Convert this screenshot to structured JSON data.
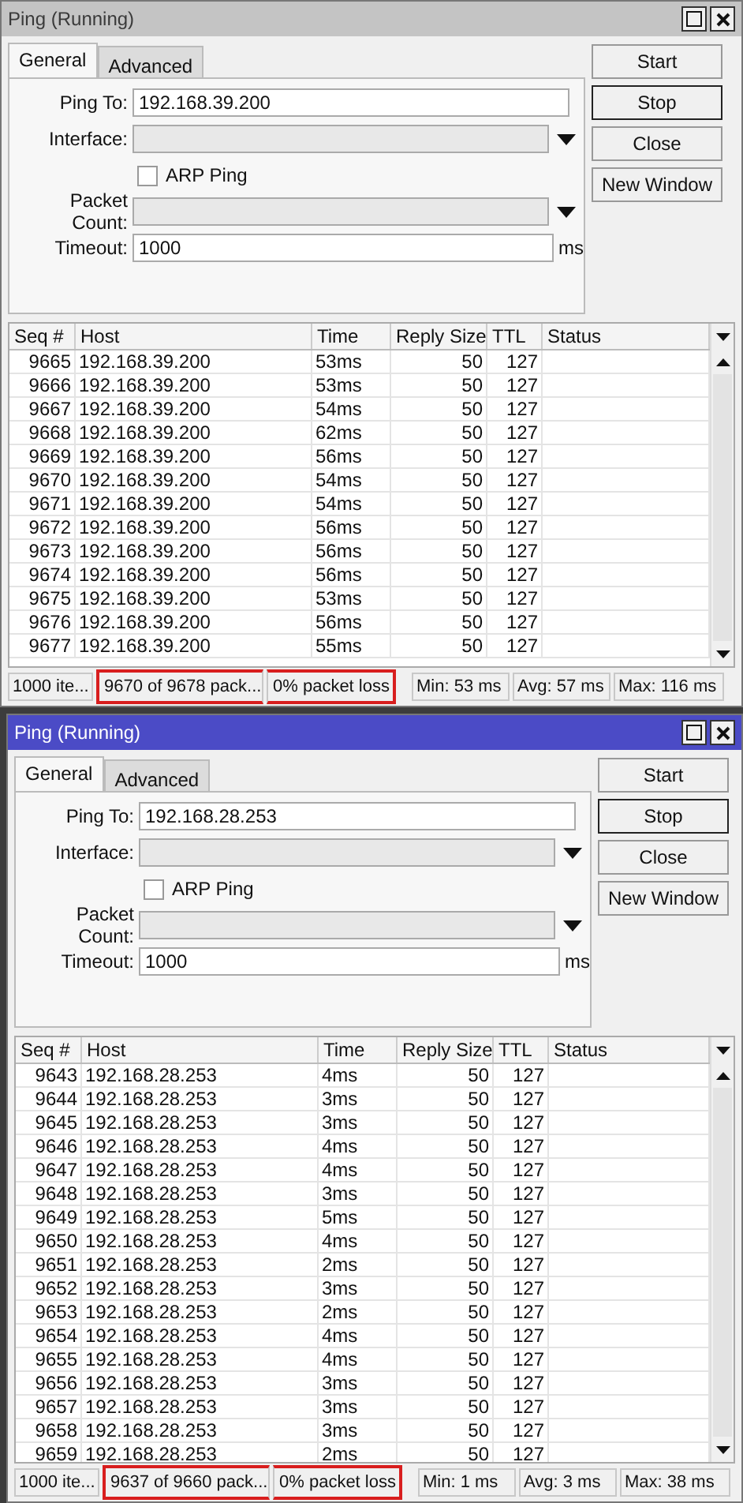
{
  "windows": [
    {
      "title": "Ping (Running)",
      "active": false,
      "tabs": [
        {
          "label": "General",
          "selected": true
        },
        {
          "label": "Advanced",
          "selected": false
        }
      ],
      "fields": [
        {
          "kind": "text",
          "label": "Ping To:",
          "value": "192.168.39.200"
        },
        {
          "kind": "dropdown",
          "label": "Interface:"
        },
        {
          "kind": "checkbox",
          "label": "ARP Ping",
          "checked": false
        },
        {
          "kind": "dropdown",
          "label": "Packet Count:"
        },
        {
          "kind": "text",
          "label": "Timeout:",
          "value": "1000",
          "unit": "ms"
        }
      ],
      "buttons": [
        {
          "label": "Start",
          "default": false
        },
        {
          "label": "Stop",
          "default": true
        },
        {
          "label": "Close",
          "default": false
        },
        {
          "label": "New Window",
          "default": false
        }
      ],
      "columns": [
        "Seq #",
        "Host",
        "Time",
        "Reply Size",
        "TTL",
        "Status"
      ],
      "rows": [
        [
          "9665",
          "192.168.39.200",
          "53ms",
          "50",
          "127"
        ],
        [
          "9666",
          "192.168.39.200",
          "53ms",
          "50",
          "127"
        ],
        [
          "9667",
          "192.168.39.200",
          "54ms",
          "50",
          "127"
        ],
        [
          "9668",
          "192.168.39.200",
          "62ms",
          "50",
          "127"
        ],
        [
          "9669",
          "192.168.39.200",
          "56ms",
          "50",
          "127"
        ],
        [
          "9670",
          "192.168.39.200",
          "54ms",
          "50",
          "127"
        ],
        [
          "9671",
          "192.168.39.200",
          "54ms",
          "50",
          "127"
        ],
        [
          "9672",
          "192.168.39.200",
          "56ms",
          "50",
          "127"
        ],
        [
          "9673",
          "192.168.39.200",
          "56ms",
          "50",
          "127"
        ],
        [
          "9674",
          "192.168.39.200",
          "56ms",
          "50",
          "127"
        ],
        [
          "9675",
          "192.168.39.200",
          "53ms",
          "50",
          "127"
        ],
        [
          "9676",
          "192.168.39.200",
          "56ms",
          "50",
          "127"
        ],
        [
          "9677",
          "192.168.39.200",
          "55ms",
          "50",
          "127"
        ]
      ],
      "status_bar": [
        {
          "text": "1000 ite...",
          "highlighted": false
        },
        {
          "text": "9670 of 9678 pack...",
          "highlighted": true
        },
        {
          "text": "0% packet loss",
          "highlighted": true
        },
        {
          "text": "Min: 53 ms",
          "highlighted": false
        },
        {
          "text": "Avg: 57 ms",
          "highlighted": false
        },
        {
          "text": "Max: 116 ms",
          "highlighted": false
        }
      ]
    },
    {
      "title": "Ping (Running)",
      "active": true,
      "tabs": [
        {
          "label": "General",
          "selected": true
        },
        {
          "label": "Advanced",
          "selected": false
        }
      ],
      "fields": [
        {
          "kind": "text",
          "label": "Ping To:",
          "value": "192.168.28.253"
        },
        {
          "kind": "dropdown",
          "label": "Interface:"
        },
        {
          "kind": "checkbox",
          "label": "ARP Ping",
          "checked": false
        },
        {
          "kind": "dropdown",
          "label": "Packet Count:"
        },
        {
          "kind": "text",
          "label": "Timeout:",
          "value": "1000",
          "unit": "ms"
        }
      ],
      "buttons": [
        {
          "label": "Start",
          "default": false
        },
        {
          "label": "Stop",
          "default": true
        },
        {
          "label": "Close",
          "default": false
        },
        {
          "label": "New Window",
          "default": false
        }
      ],
      "columns": [
        "Seq #",
        "Host",
        "Time",
        "Reply Size",
        "TTL",
        "Status"
      ],
      "rows": [
        [
          "9643",
          "192.168.28.253",
          "4ms",
          "50",
          "127"
        ],
        [
          "9644",
          "192.168.28.253",
          "3ms",
          "50",
          "127"
        ],
        [
          "9645",
          "192.168.28.253",
          "3ms",
          "50",
          "127"
        ],
        [
          "9646",
          "192.168.28.253",
          "4ms",
          "50",
          "127"
        ],
        [
          "9647",
          "192.168.28.253",
          "4ms",
          "50",
          "127"
        ],
        [
          "9648",
          "192.168.28.253",
          "3ms",
          "50",
          "127"
        ],
        [
          "9649",
          "192.168.28.253",
          "5ms",
          "50",
          "127"
        ],
        [
          "9650",
          "192.168.28.253",
          "4ms",
          "50",
          "127"
        ],
        [
          "9651",
          "192.168.28.253",
          "2ms",
          "50",
          "127"
        ],
        [
          "9652",
          "192.168.28.253",
          "3ms",
          "50",
          "127"
        ],
        [
          "9653",
          "192.168.28.253",
          "2ms",
          "50",
          "127"
        ],
        [
          "9654",
          "192.168.28.253",
          "4ms",
          "50",
          "127"
        ],
        [
          "9655",
          "192.168.28.253",
          "4ms",
          "50",
          "127"
        ],
        [
          "9656",
          "192.168.28.253",
          "3ms",
          "50",
          "127"
        ],
        [
          "9657",
          "192.168.28.253",
          "3ms",
          "50",
          "127"
        ],
        [
          "9658",
          "192.168.28.253",
          "3ms",
          "50",
          "127"
        ],
        [
          "9659",
          "192.168.28.253",
          "2ms",
          "50",
          "127"
        ]
      ],
      "status_bar": [
        {
          "text": "1000 ite...",
          "highlighted": false
        },
        {
          "text": "9637 of 9660 pack...",
          "highlighted": true
        },
        {
          "text": "0% packet loss",
          "highlighted": true
        },
        {
          "text": "Min: 1 ms",
          "highlighted": false
        },
        {
          "text": "Avg: 3 ms",
          "highlighted": false
        },
        {
          "text": "Max: 38 ms",
          "highlighted": false
        }
      ]
    }
  ]
}
